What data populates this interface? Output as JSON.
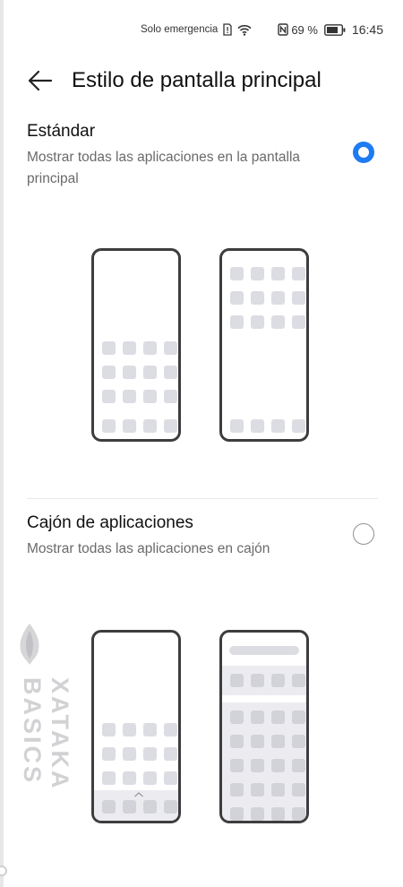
{
  "status_bar": {
    "carrier_text": "Solo emergencia",
    "battery_percent": "69 %",
    "time": "16:45",
    "icons": [
      "sim-alert-icon",
      "wifi-icon",
      "nfc-icon",
      "battery-icon"
    ]
  },
  "header": {
    "back_icon": "arrow-left-icon",
    "title": "Estilo de pantalla principal"
  },
  "options": [
    {
      "title": "Estándar",
      "description": "Mostrar todas las aplicaciones en la pantalla principal",
      "selected": true
    },
    {
      "title": "Cajón de aplicaciones",
      "description": "Mostrar todas las aplicaciones en cajón",
      "selected": false
    }
  ],
  "watermark": {
    "text": "XATAKA BASICS"
  },
  "colors": {
    "accent": "#1f7bf2",
    "tile": "#dcdce3",
    "frame": "#3d3d3f"
  }
}
